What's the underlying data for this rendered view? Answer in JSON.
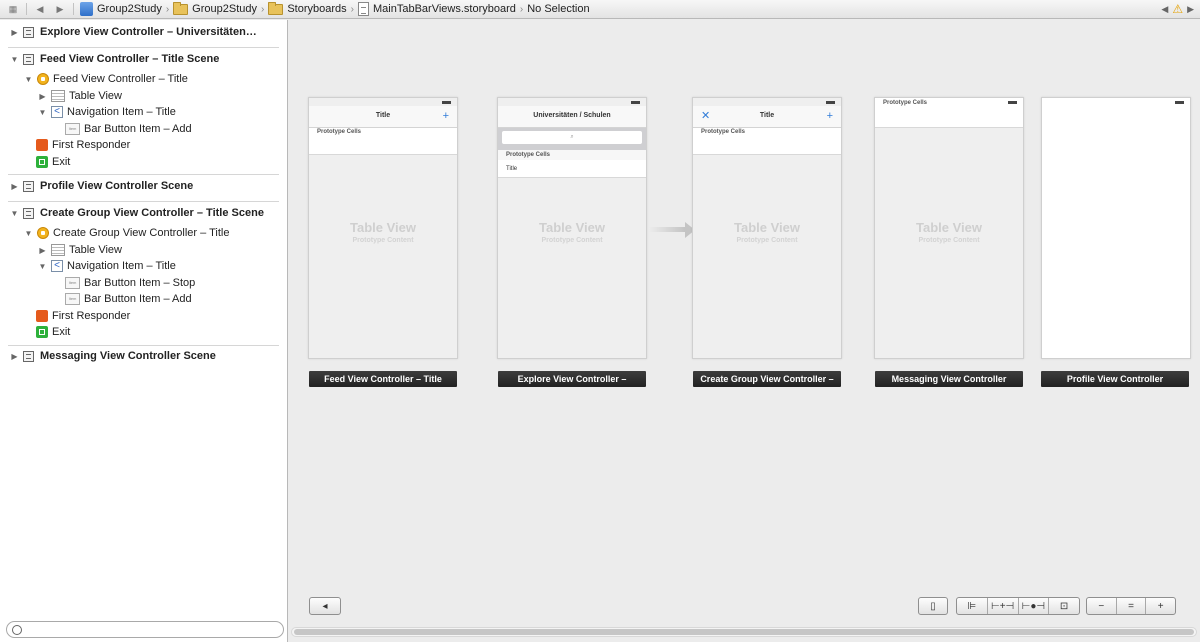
{
  "jumpbar": {
    "crumbs": [
      "Group2Study",
      "Group2Study",
      "Storyboards",
      "MainTabBarViews.storyboard",
      "No Selection"
    ]
  },
  "outline": {
    "items": [
      "Explore View Controller – Universitäten…",
      "Feed View Controller – Title Scene",
      "Feed View Controller – Title",
      "Table View",
      "Navigation Item – Title",
      "Bar Button Item – Add",
      "First Responder",
      "Exit",
      "Profile View Controller Scene",
      "Create Group View Controller – Title Scene",
      "Create Group View Controller – Title",
      "Table View",
      "Navigation Item – Title",
      "Bar Button Item – Stop",
      "Bar Button Item – Add",
      "First Responder",
      "Exit",
      "Messaging View Controller Scene"
    ]
  },
  "scenes": {
    "feed": {
      "nav_title": "Title",
      "nav_plus": "+",
      "proto": "Prototype Cells",
      "tv": "Table View",
      "tv_sub": "Prototype Content",
      "label": "Feed View Controller – Title"
    },
    "explore": {
      "nav_title": "Universitäten / Schulen",
      "search_glyph": "⌕",
      "proto": "Prototype Cells",
      "cell": "Title",
      "tv": "Table View",
      "tv_sub": "Prototype Content",
      "label": "Explore View Controller –"
    },
    "create": {
      "nav_title": "Title",
      "nav_x": "✕",
      "nav_plus": "+",
      "proto": "Prototype Cells",
      "tv": "Table View",
      "tv_sub": "Prototype Content",
      "label": "Create Group View Controller –"
    },
    "messaging": {
      "proto": "Prototype Cells",
      "tv": "Table View",
      "tv_sub": "Prototype Content",
      "label": "Messaging View Controller"
    },
    "profile": {
      "label": "Profile View Controller"
    }
  },
  "glyphs": {
    "grid": "▦",
    "back": "◀",
    "forward": "▶",
    "chev": "›",
    "tri_open": "▼",
    "tri_closed": "▶",
    "warn": "⚠",
    "nav_back": "<",
    "bbi": "Item",
    "sidebar_toggle": "◂",
    "device": "▯",
    "align": "⊫",
    "pin": "⊢+⊣",
    "resolve": "⊢●⊣",
    "resize": "⊡",
    "zoom_out": "−",
    "zoom_fit": "=",
    "zoom_in": "+"
  }
}
